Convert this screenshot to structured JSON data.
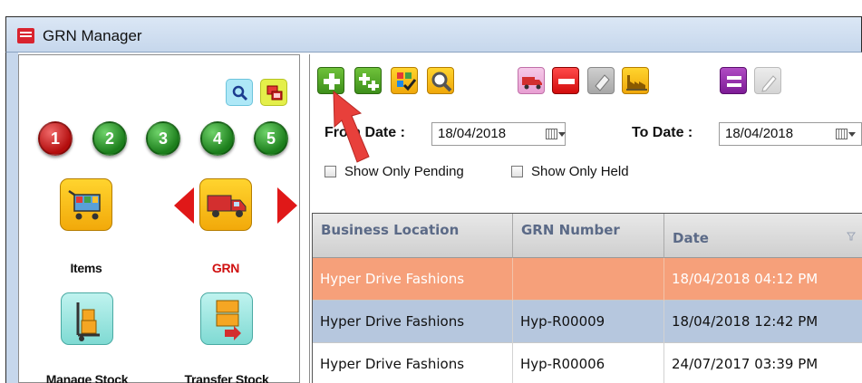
{
  "window": {
    "title": "GRN Manager"
  },
  "left_panel": {
    "numbered_buttons": [
      "1",
      "2",
      "3",
      "4",
      "5"
    ],
    "modules": {
      "items": {
        "label": "Items"
      },
      "grn": {
        "label": "GRN"
      },
      "manage_stock": {
        "label": "Manage Stock"
      },
      "transfer_stock": {
        "label": "Transfer Stock"
      }
    }
  },
  "filters": {
    "from_date_label": "From Date :",
    "from_date_value": "18/04/2018",
    "to_date_label": "To Date :",
    "to_date_value": "18/04/2018",
    "show_only_pending": "Show Only Pending",
    "show_only_held": "Show Only Held"
  },
  "grid": {
    "columns": [
      "Business Location",
      "GRN Number",
      "Date"
    ],
    "rows": [
      {
        "location": "Hyper Drive Fashions",
        "grn": "",
        "date": "18/04/2018 04:12 PM",
        "state": "highlighted"
      },
      {
        "location": "Hyper Drive Fashions",
        "grn": "Hyp-R00009",
        "date": "18/04/2018 12:42 PM",
        "state": "selected"
      },
      {
        "location": "Hyper Drive Fashions",
        "grn": "Hyp-R00006",
        "date": "24/07/2017 03:39 PM",
        "state": "normal"
      }
    ]
  },
  "colors": {
    "row_highlight": "#f6a07a",
    "row_selected": "#b6c7de",
    "grid_header_text": "#5b6a87",
    "annotation_arrow": "#e8403b"
  }
}
